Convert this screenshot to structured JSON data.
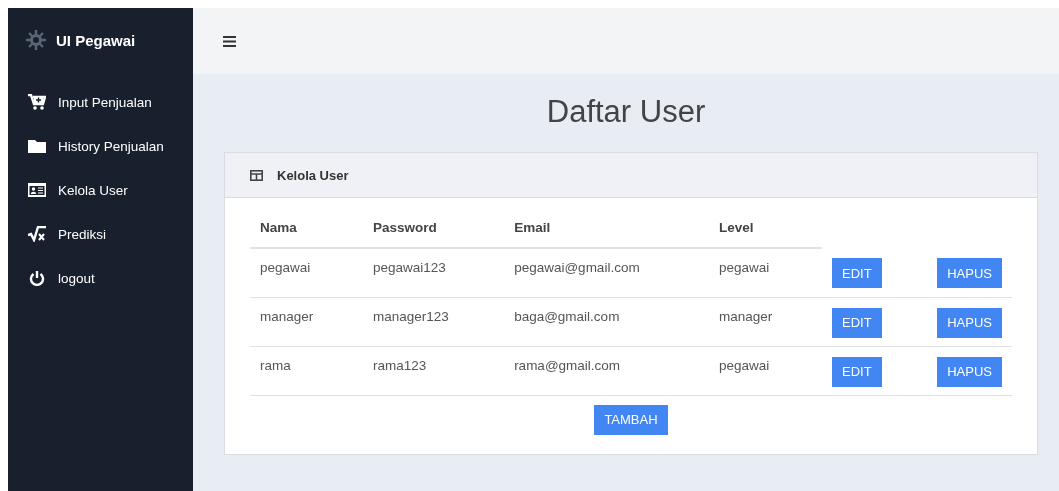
{
  "brand": {
    "title": "UI Pegawai"
  },
  "sidebar": {
    "items": [
      {
        "label": "Input Penjualan"
      },
      {
        "label": "History Penjualan"
      },
      {
        "label": "Kelola User"
      },
      {
        "label": "Prediksi"
      },
      {
        "label": "logout"
      }
    ]
  },
  "page_title": "Daftar User",
  "card": {
    "title": "Kelola User",
    "table": {
      "columns": [
        "Nama",
        "Password",
        "Email",
        "Level"
      ],
      "rows": [
        {
          "cells": [
            "pegawai",
            "pegawai123",
            "pegawai@gmail.com",
            "pegawai"
          ],
          "edit": "EDIT",
          "delete": "HAPUS"
        },
        {
          "cells": [
            "manager",
            "manager123",
            "baga@gmail.com",
            "manager"
          ],
          "edit": "EDIT",
          "delete": "HAPUS"
        },
        {
          "cells": [
            "rama",
            "rama123",
            "rama@gmail.com",
            "pegawai"
          ],
          "edit": "EDIT",
          "delete": "HAPUS"
        }
      ]
    },
    "add_button": "TAMBAH"
  }
}
